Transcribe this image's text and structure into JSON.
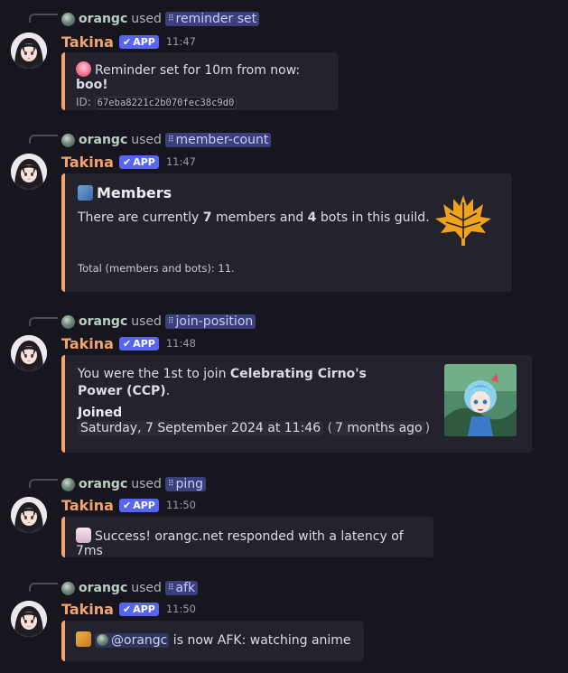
{
  "messages": [
    {
      "used_by": "orangc",
      "used_word": "used",
      "command": "reminder set",
      "author": "Takina",
      "badge": "APP",
      "time": "11:47",
      "embed": {
        "line1_pre": "Reminder set for 10m from now: ",
        "line1_bold": "boo!",
        "id_label": "ID:",
        "id_value": "67eba8221c2b070fec38c9d0"
      }
    },
    {
      "used_by": "orangc",
      "used_word": "used",
      "command": "member-count",
      "author": "Takina",
      "badge": "APP",
      "time": "11:47",
      "embed": {
        "title": "Members",
        "desc_1": "There are currently ",
        "members": "7",
        "desc_2": " members and ",
        "bots": "4",
        "desc_3": " bots in this guild.",
        "footer": "Total (members and bots): 11."
      }
    },
    {
      "used_by": "orangc",
      "used_word": "used",
      "command": "join-position",
      "author": "Takina",
      "badge": "APP",
      "time": "11:48",
      "embed": {
        "desc_1": "You were the 1st to join ",
        "guild_bold": "Celebrating Cirno's Power (CCP)",
        "desc_2": ".",
        "field_name": "Joined",
        "field_date": "Saturday, 7 September 2024 at 11:46",
        "field_relative": "7 months ago"
      }
    },
    {
      "used_by": "orangc",
      "used_word": "used",
      "command": "ping",
      "author": "Takina",
      "badge": "APP",
      "time": "11:50",
      "embed": {
        "text": "Success! orangc.net responded with a latency of 7ms"
      }
    },
    {
      "used_by": "orangc",
      "used_word": "used",
      "command": "afk",
      "author": "Takina",
      "badge": "APP",
      "time": "11:50",
      "embed": {
        "mention": "@orangc",
        "text": " is now AFK: watching anime"
      }
    }
  ],
  "colors": {
    "embed_accent": "#f3a46b",
    "author": "#f3a46b",
    "app_badge": "#5865f2",
    "command_chip": "#3b3f7c"
  },
  "icons": {
    "reminder_emoji": "heart-emoji-icon",
    "members_emoji": "busts-in-silhouette-icon",
    "maple_thumbnail": "maple-leaf-icon",
    "ping_emoji": "ghost-icon",
    "afk_emoji": "cat-icon"
  }
}
